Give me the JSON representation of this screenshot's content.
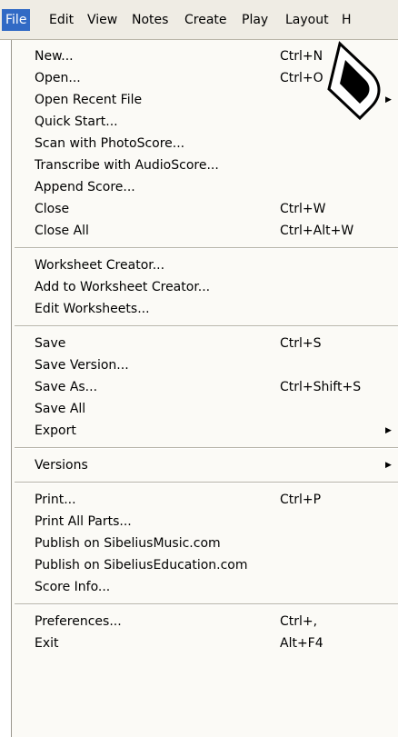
{
  "menubar": {
    "items": [
      "File",
      "Edit",
      "View",
      "Notes",
      "Create",
      "Play",
      "Layout",
      "H"
    ]
  },
  "menu": {
    "items": [
      {
        "label": "New...",
        "shortcut": "Ctrl+N"
      },
      {
        "label": "Open...",
        "shortcut": "Ctrl+O"
      },
      {
        "label": "Open Recent File",
        "submenu": true
      },
      {
        "label": "Quick Start..."
      },
      {
        "label": "Scan with PhotoScore..."
      },
      {
        "label": "Transcribe with AudioScore..."
      },
      {
        "label": "Append Score..."
      },
      {
        "label": "Close",
        "shortcut": "Ctrl+W"
      },
      {
        "label": "Close All",
        "shortcut": "Ctrl+Alt+W"
      },
      {
        "separator": true
      },
      {
        "label": "Worksheet Creator..."
      },
      {
        "label": "Add to Worksheet Creator..."
      },
      {
        "label": "Edit Worksheets..."
      },
      {
        "separator": true
      },
      {
        "label": "Save",
        "shortcut": "Ctrl+S"
      },
      {
        "label": "Save Version..."
      },
      {
        "label": "Save As...",
        "shortcut": "Ctrl+Shift+S"
      },
      {
        "label": "Save All"
      },
      {
        "label": "Export",
        "submenu": true
      },
      {
        "separator": true
      },
      {
        "label": "Versions",
        "submenu": true
      },
      {
        "separator": true
      },
      {
        "label": "Print...",
        "shortcut": "Ctrl+P"
      },
      {
        "label": "Print All Parts..."
      },
      {
        "label": "Publish on SibeliusMusic.com"
      },
      {
        "label": "Publish on SibeliusEducation.com"
      },
      {
        "label": "Score Info..."
      },
      {
        "separator": true
      },
      {
        "label": "Preferences...",
        "shortcut": "Ctrl+,"
      },
      {
        "label": "Exit",
        "shortcut": "Alt+F4"
      }
    ]
  },
  "colors": {
    "selection": "#316ac5",
    "menu_bg": "#fbfaf6",
    "menubar_bg": "#efece4"
  }
}
